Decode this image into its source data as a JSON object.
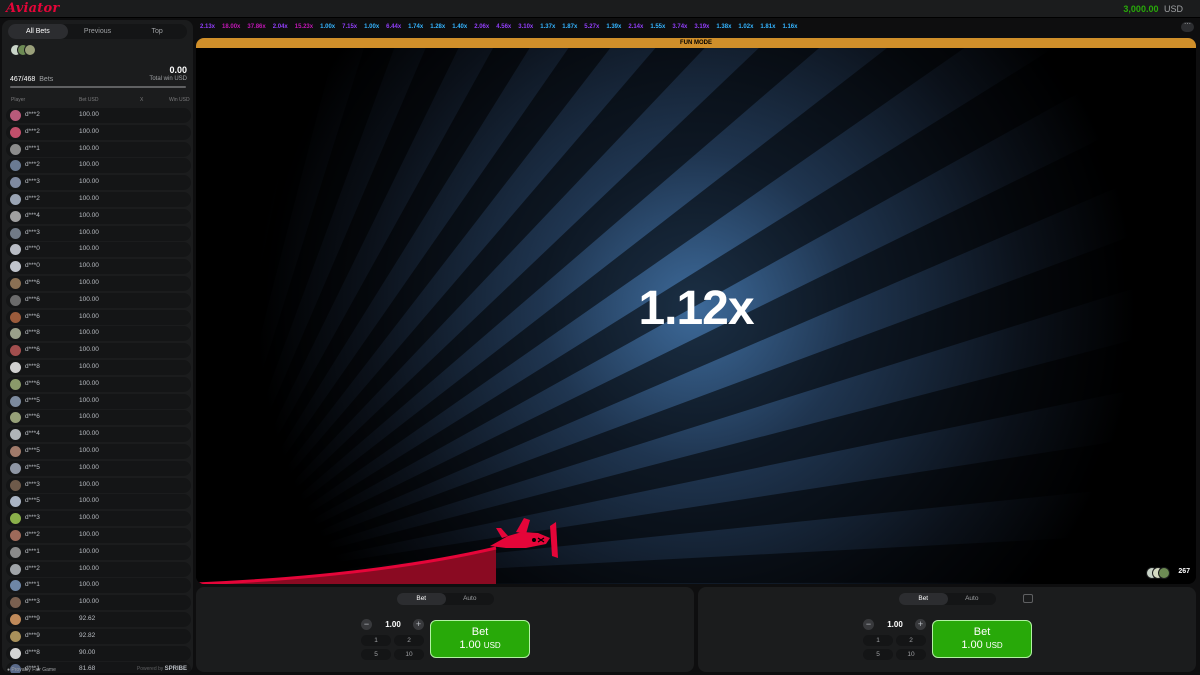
{
  "app": {
    "logo": "Aviator",
    "balance": "3,000.00",
    "currency": "USD",
    "accent_red": "#e50539",
    "accent_green": "#28a909"
  },
  "sidebar": {
    "tabs": [
      "All Bets",
      "Previous",
      "Top"
    ],
    "bets_count": "467/468",
    "bets_label": "Bets",
    "bets_progress": 0.998,
    "total_win": "0.00",
    "total_win_label": "Total win USD",
    "columns": {
      "player": "Player",
      "bet": "Bet USD",
      "x": "X",
      "win": "Win USD"
    },
    "rows": [
      {
        "player": "d***2",
        "bet": "100.00",
        "avatar": "#b85a7a"
      },
      {
        "player": "d***2",
        "bet": "100.00",
        "avatar": "#c24f6b"
      },
      {
        "player": "d***1",
        "bet": "100.00",
        "avatar": "#8c8c8c"
      },
      {
        "player": "d***2",
        "bet": "100.00",
        "avatar": "#6a7a92"
      },
      {
        "player": "d***3",
        "bet": "100.00",
        "avatar": "#7f8aa0"
      },
      {
        "player": "d***2",
        "bet": "100.00",
        "avatar": "#9aa4b4"
      },
      {
        "player": "d***4",
        "bet": "100.00",
        "avatar": "#a0a0a0"
      },
      {
        "player": "d***3",
        "bet": "100.00",
        "avatar": "#717a86"
      },
      {
        "player": "d***0",
        "bet": "100.00",
        "avatar": "#b8bcc4"
      },
      {
        "player": "d***0",
        "bet": "100.00",
        "avatar": "#c0c4cc"
      },
      {
        "player": "d***6",
        "bet": "100.00",
        "avatar": "#8a7054"
      },
      {
        "player": "d***6",
        "bet": "100.00",
        "avatar": "#6b6b6b"
      },
      {
        "player": "d***6",
        "bet": "100.00",
        "avatar": "#9b5b3b"
      },
      {
        "player": "d***8",
        "bet": "100.00",
        "avatar": "#9aa08a"
      },
      {
        "player": "d***6",
        "bet": "100.00",
        "avatar": "#a24e4e"
      },
      {
        "player": "d***8",
        "bet": "100.00",
        "avatar": "#d0d0d0"
      },
      {
        "player": "d***6",
        "bet": "100.00",
        "avatar": "#8a9a6a"
      },
      {
        "player": "d***5",
        "bet": "100.00",
        "avatar": "#7c8a9e"
      },
      {
        "player": "d***6",
        "bet": "100.00",
        "avatar": "#96a078"
      },
      {
        "player": "d***4",
        "bet": "100.00",
        "avatar": "#b0b4b8"
      },
      {
        "player": "d***5",
        "bet": "100.00",
        "avatar": "#a07a6a"
      },
      {
        "player": "d***5",
        "bet": "100.00",
        "avatar": "#8e96a4"
      },
      {
        "player": "d***3",
        "bet": "100.00",
        "avatar": "#6e5a4a"
      },
      {
        "player": "d***5",
        "bet": "100.00",
        "avatar": "#aab4c4"
      },
      {
        "player": "d***3",
        "bet": "100.00",
        "avatar": "#8ab04a"
      },
      {
        "player": "d***2",
        "bet": "100.00",
        "avatar": "#9e6a5a"
      },
      {
        "player": "d***1",
        "bet": "100.00",
        "avatar": "#8a8a8a"
      },
      {
        "player": "d***2",
        "bet": "100.00",
        "avatar": "#a0a4a8"
      },
      {
        "player": "d***1",
        "bet": "100.00",
        "avatar": "#6e86a6"
      },
      {
        "player": "d***3",
        "bet": "100.00",
        "avatar": "#7a6050"
      },
      {
        "player": "d***9",
        "bet": "92.62",
        "avatar": "#c08a5a"
      },
      {
        "player": "d***9",
        "bet": "92.82",
        "avatar": "#a8905a"
      },
      {
        "player": "d***8",
        "bet": "90.00",
        "avatar": "#d4d4d4"
      },
      {
        "player": "d***1",
        "bet": "81.68",
        "avatar": "#5a6a8a"
      }
    ],
    "footer_fair": "Provably Fair Game",
    "footer_powered": "Powered by",
    "footer_brand": "SPRIBE"
  },
  "history": [
    {
      "v": "2.13x",
      "c": "#913ef8"
    },
    {
      "v": "18.00x",
      "c": "#c017b4"
    },
    {
      "v": "37.86x",
      "c": "#c017b4"
    },
    {
      "v": "2.04x",
      "c": "#913ef8"
    },
    {
      "v": "15.23x",
      "c": "#c017b4"
    },
    {
      "v": "1.00x",
      "c": "#34b4ff"
    },
    {
      "v": "7.15x",
      "c": "#913ef8"
    },
    {
      "v": "1.00x",
      "c": "#34b4ff"
    },
    {
      "v": "6.44x",
      "c": "#913ef8"
    },
    {
      "v": "1.74x",
      "c": "#34b4ff"
    },
    {
      "v": "1.28x",
      "c": "#34b4ff"
    },
    {
      "v": "1.40x",
      "c": "#34b4ff"
    },
    {
      "v": "2.06x",
      "c": "#913ef8"
    },
    {
      "v": "4.56x",
      "c": "#913ef8"
    },
    {
      "v": "3.10x",
      "c": "#913ef8"
    },
    {
      "v": "1.37x",
      "c": "#34b4ff"
    },
    {
      "v": "1.87x",
      "c": "#34b4ff"
    },
    {
      "v": "5.27x",
      "c": "#913ef8"
    },
    {
      "v": "1.39x",
      "c": "#34b4ff"
    },
    {
      "v": "2.14x",
      "c": "#913ef8"
    },
    {
      "v": "1.55x",
      "c": "#34b4ff"
    },
    {
      "v": "3.74x",
      "c": "#913ef8"
    },
    {
      "v": "3.19x",
      "c": "#913ef8"
    },
    {
      "v": "1.38x",
      "c": "#34b4ff"
    },
    {
      "v": "1.02x",
      "c": "#34b4ff"
    },
    {
      "v": "1.81x",
      "c": "#34b4ff"
    },
    {
      "v": "1.16x",
      "c": "#34b4ff"
    }
  ],
  "game": {
    "mode_banner": "FUN MODE",
    "multiplier": "1.12x",
    "online_count": "267"
  },
  "bet_panels": [
    {
      "tabs": [
        "Bet",
        "Auto"
      ],
      "amount": "1.00",
      "quick": [
        "1",
        "2",
        "5",
        "10"
      ],
      "button_title": "Bet",
      "button_amount": "1.00",
      "button_currency": "USD"
    },
    {
      "tabs": [
        "Bet",
        "Auto"
      ],
      "amount": "1.00",
      "quick": [
        "1",
        "2",
        "5",
        "10"
      ],
      "button_title": "Bet",
      "button_amount": "1.00",
      "button_currency": "USD"
    }
  ]
}
